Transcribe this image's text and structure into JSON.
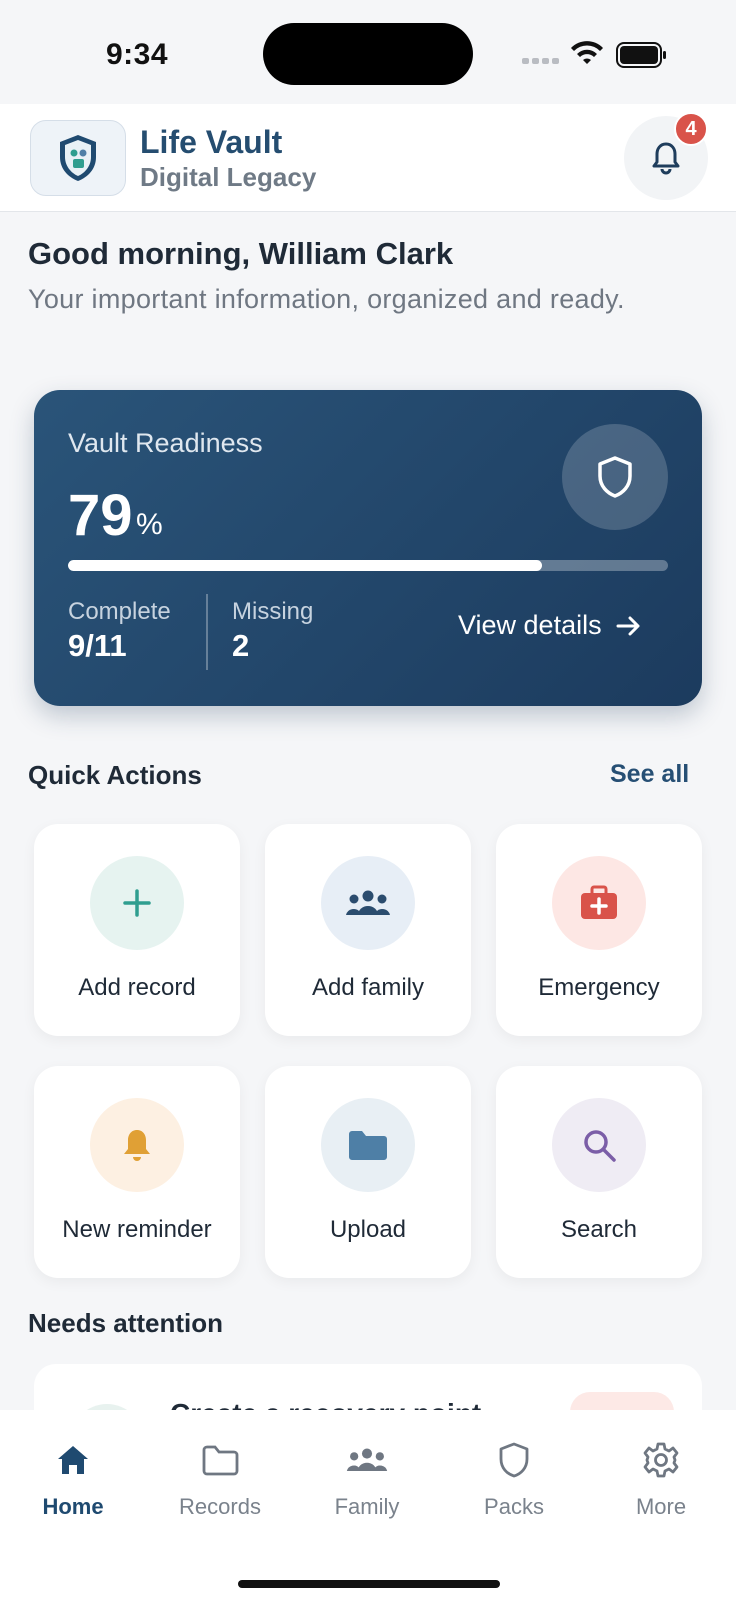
{
  "status_bar": {
    "time": "9:34"
  },
  "header": {
    "title": "Life Vault",
    "subtitle": "Digital Legacy",
    "notification_count": "4"
  },
  "greeting": {
    "title": "Good morning, William Clark",
    "subtitle": "Your important information, organized and ready."
  },
  "readiness": {
    "label": "Vault Readiness",
    "value": "79",
    "unit": "%",
    "progress_fraction": 0.79,
    "complete_label": "Complete",
    "complete_value": "9/11",
    "missing_label": "Missing",
    "missing_value": "2",
    "view_details": "View details"
  },
  "quick_actions": {
    "title": "Quick Actions",
    "see_all": "See all",
    "items": [
      {
        "label": "Add record",
        "icon": "plus-icon",
        "color": "#2f9e8f"
      },
      {
        "label": "Add family",
        "icon": "people-icon",
        "color": "#2b4c6e"
      },
      {
        "label": "Emergency",
        "icon": "medkit-icon",
        "color": "#d9534a"
      },
      {
        "label": "New reminder",
        "icon": "bell-icon",
        "color": "#e0a035"
      },
      {
        "label": "Upload",
        "icon": "folder-icon",
        "color": "#4e7fa6"
      },
      {
        "label": "Search",
        "icon": "search-icon",
        "color": "#7b5ea7"
      }
    ]
  },
  "attention": {
    "title": "Needs attention",
    "first_item": "Create a recovery point"
  },
  "tabs": [
    {
      "label": "Home",
      "icon": "home-icon",
      "active": true
    },
    {
      "label": "Records",
      "icon": "folder-outline-icon"
    },
    {
      "label": "Family",
      "icon": "people-icon"
    },
    {
      "label": "Packs",
      "icon": "shield-icon"
    },
    {
      "label": "More",
      "icon": "gear-icon"
    }
  ]
}
